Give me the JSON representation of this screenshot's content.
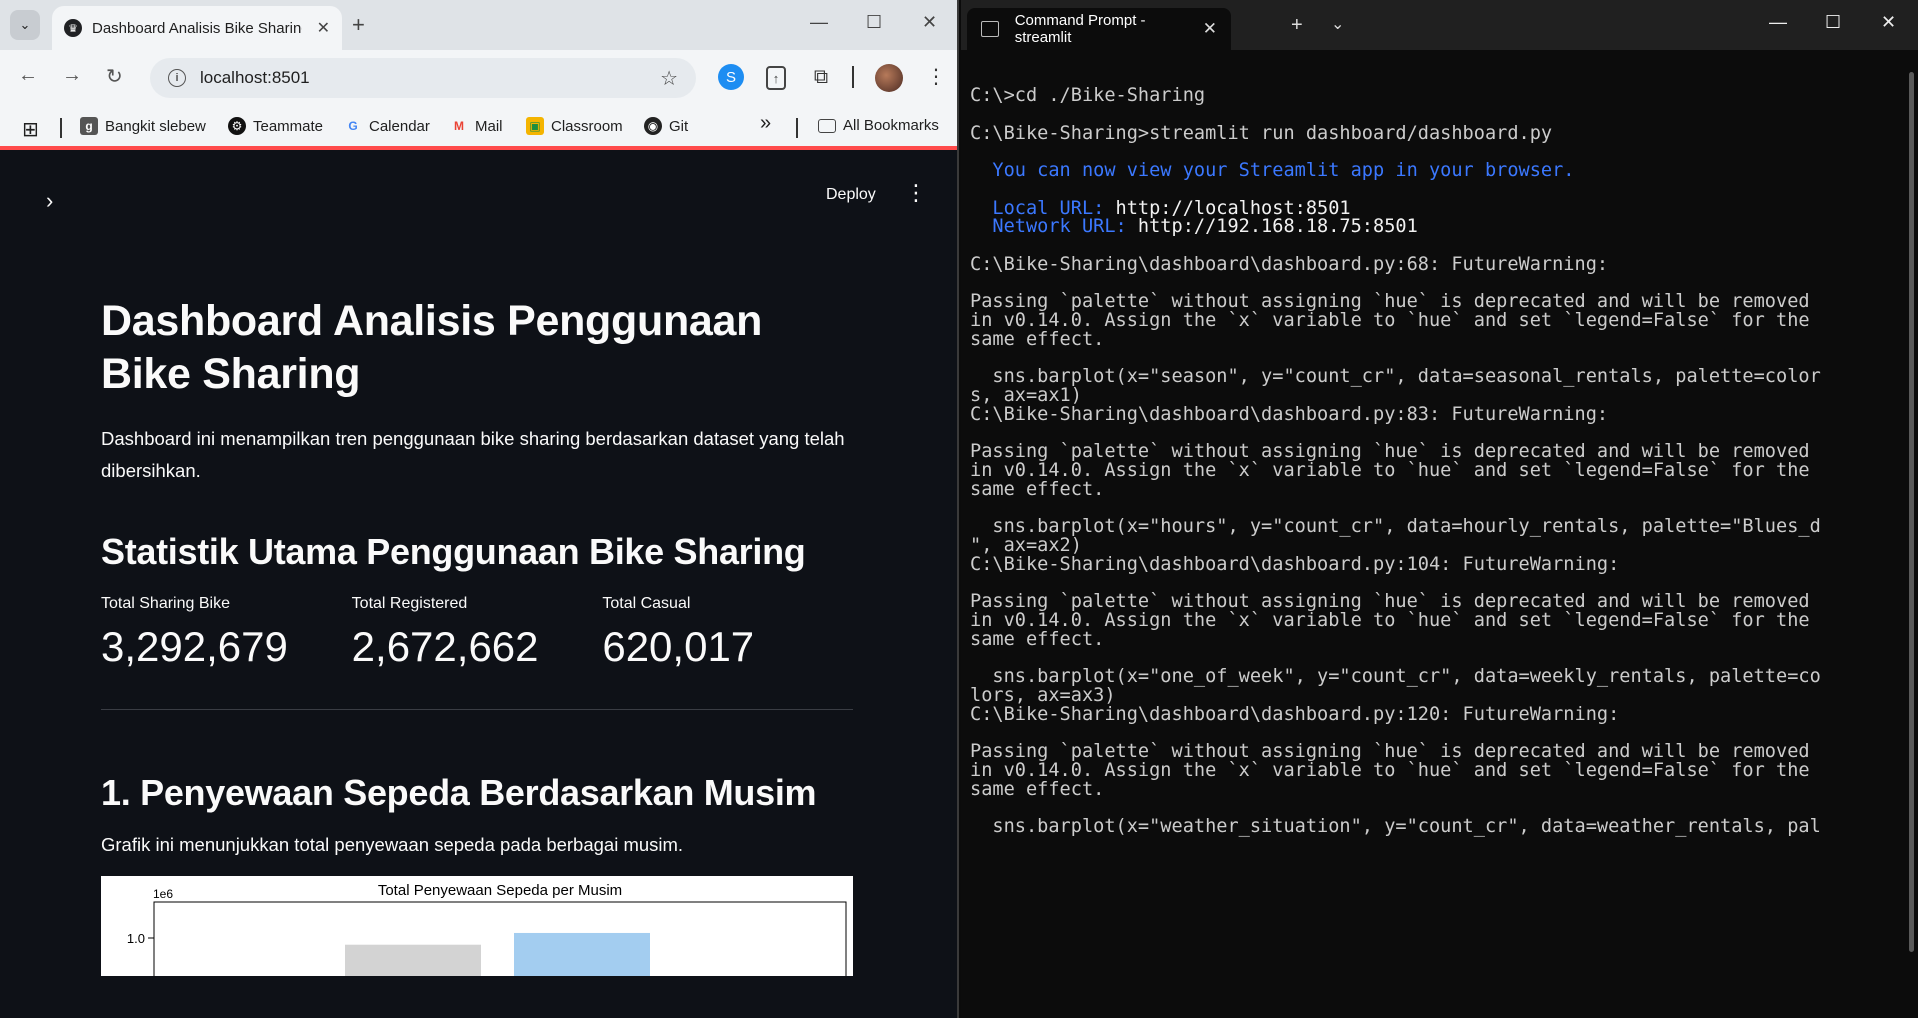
{
  "browser": {
    "tab_title": "Dashboard Analisis Bike Sharing",
    "url": "localhost:8501",
    "bookmarks": [
      "Bangkit slebew",
      "Teammate",
      "Calendar",
      "Mail",
      "Classroom",
      "Git"
    ],
    "all_bookmarks_label": "All Bookmarks",
    "more_bookmarks": "»"
  },
  "streamlit": {
    "deploy_label": "Deploy",
    "title": "Dashboard Analisis Penggunaan Bike Sharing",
    "intro": "Dashboard ini menampilkan tren penggunaan bike sharing berdasarkan dataset yang telah dibersihkan.",
    "stats_heading": "Statistik Utama Penggunaan Bike Sharing",
    "metrics": [
      {
        "label": "Total Sharing Bike",
        "value": "3,292,679"
      },
      {
        "label": "Total Registered",
        "value": "2,672,662"
      },
      {
        "label": "Total Casual",
        "value": "620,017"
      }
    ],
    "section1_heading": "1. Penyewaan Sepeda Berdasarkan Musim",
    "section1_text": "Grafik ini menunjukkan total penyewaan sepeda pada berbagai musim."
  },
  "chart_data": {
    "type": "bar",
    "title": "Total Penyewaan Sepeda per Musim",
    "y_multiplier_label": "1e6",
    "y_tick_visible": "1.0",
    "visible_bars": [
      {
        "color": "#d3d3d3",
        "value": 0.92
      },
      {
        "color": "#a3cdf0",
        "value": 1.06
      }
    ],
    "ylim": [
      0,
      1.1
    ]
  },
  "terminal": {
    "tab_title": "Command Prompt - streamlit",
    "lines": [
      {
        "t": "C:\\>cd ./Bike-Sharing",
        "c": ""
      },
      {
        "t": "",
        "c": ""
      },
      {
        "t": "C:\\Bike-Sharing>streamlit run dashboard/dashboard.py",
        "c": ""
      },
      {
        "t": "",
        "c": ""
      },
      {
        "t": "  You can now view your Streamlit app in your browser.",
        "c": "blue"
      },
      {
        "t": "",
        "c": ""
      },
      {
        "t": "  Local URL: |http://localhost:8501",
        "c": "url"
      },
      {
        "t": "  Network URL: |http://192.168.18.75:8501",
        "c": "url"
      },
      {
        "t": "",
        "c": ""
      },
      {
        "t": "C:\\Bike-Sharing\\dashboard\\dashboard.py:68: FutureWarning:",
        "c": ""
      },
      {
        "t": "",
        "c": ""
      },
      {
        "t": "Passing `palette` without assigning `hue` is deprecated and will be removed",
        "c": ""
      },
      {
        "t": "in v0.14.0. Assign the `x` variable to `hue` and set `legend=False` for the",
        "c": ""
      },
      {
        "t": "same effect.",
        "c": ""
      },
      {
        "t": "",
        "c": ""
      },
      {
        "t": "  sns.barplot(x=\"season\", y=\"count_cr\", data=seasonal_rentals, palette=color",
        "c": ""
      },
      {
        "t": "s, ax=ax1)",
        "c": ""
      },
      {
        "t": "C:\\Bike-Sharing\\dashboard\\dashboard.py:83: FutureWarning:",
        "c": ""
      },
      {
        "t": "",
        "c": ""
      },
      {
        "t": "Passing `palette` without assigning `hue` is deprecated and will be removed",
        "c": ""
      },
      {
        "t": "in v0.14.0. Assign the `x` variable to `hue` and set `legend=False` for the",
        "c": ""
      },
      {
        "t": "same effect.",
        "c": ""
      },
      {
        "t": "",
        "c": ""
      },
      {
        "t": "  sns.barplot(x=\"hours\", y=\"count_cr\", data=hourly_rentals, palette=\"Blues_d",
        "c": ""
      },
      {
        "t": "\", ax=ax2)",
        "c": ""
      },
      {
        "t": "C:\\Bike-Sharing\\dashboard\\dashboard.py:104: FutureWarning:",
        "c": ""
      },
      {
        "t": "",
        "c": ""
      },
      {
        "t": "Passing `palette` without assigning `hue` is deprecated and will be removed",
        "c": ""
      },
      {
        "t": "in v0.14.0. Assign the `x` variable to `hue` and set `legend=False` for the",
        "c": ""
      },
      {
        "t": "same effect.",
        "c": ""
      },
      {
        "t": "",
        "c": ""
      },
      {
        "t": "  sns.barplot(x=\"one_of_week\", y=\"count_cr\", data=weekly_rentals, palette=co",
        "c": ""
      },
      {
        "t": "lors, ax=ax3)",
        "c": ""
      },
      {
        "t": "C:\\Bike-Sharing\\dashboard\\dashboard.py:120: FutureWarning:",
        "c": ""
      },
      {
        "t": "",
        "c": ""
      },
      {
        "t": "Passing `palette` without assigning `hue` is deprecated and will be removed",
        "c": ""
      },
      {
        "t": "in v0.14.0. Assign the `x` variable to `hue` and set `legend=False` for the",
        "c": ""
      },
      {
        "t": "same effect.",
        "c": ""
      },
      {
        "t": "",
        "c": ""
      },
      {
        "t": "  sns.barplot(x=\"weather_situation\", y=\"count_cr\", data=weather_rentals, pal",
        "c": ""
      }
    ]
  },
  "colors": {
    "streamlit_bg": "#0e1117",
    "streamlit_accent": "#ff4b4b",
    "terminal_bg": "#0c0c0c",
    "terminal_blue": "#3b78ff"
  }
}
